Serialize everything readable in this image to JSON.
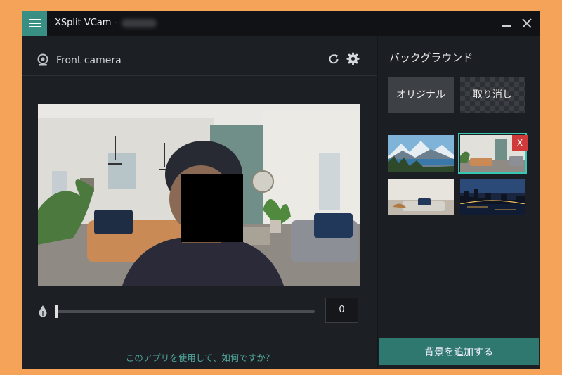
{
  "window": {
    "title": "XSplit VCam -"
  },
  "camera": {
    "label": "Front camera"
  },
  "slider": {
    "value": "0",
    "level": 0
  },
  "feedback": {
    "text": "このアプリを使用して、如何ですか？"
  },
  "background_panel": {
    "title": "バックグラウンド",
    "original_label": "オリジナル",
    "undo_label": "取り消し",
    "remove_badge": "X",
    "add_label": "背景を追加する",
    "thumbnails": [
      "mountain-lake",
      "living-room",
      "living-room-sofa",
      "city-night-bridge"
    ],
    "selected_index": 1
  },
  "colors": {
    "accent": "#3a8f85",
    "add_button": "#2f786f",
    "selected_outline": "#37c8b4",
    "remove_badge": "#d03a3a",
    "outer_background": "#f6a35a"
  }
}
